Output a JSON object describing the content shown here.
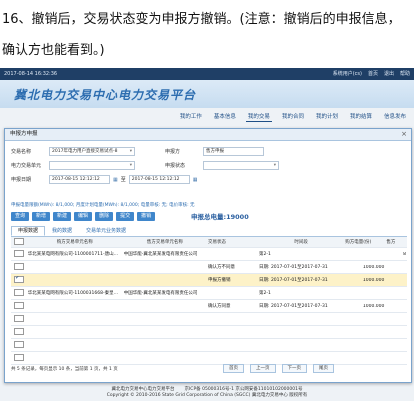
{
  "caption": {
    "line1": "16、撤销后，交易状态变为申报方撤销。(注意：撤销后的申报信息，",
    "line2": "确认方也能看到。)"
  },
  "topbar": {
    "left": "2017-08-14 16:32:36",
    "user": "系统用户(cs)",
    "home": "首页",
    "logout": "退出",
    "help": "帮助"
  },
  "banner": {
    "title": "冀北电力交易中心电力交易平台"
  },
  "nav": [
    "我的工作",
    "基本信息",
    "我的交易",
    "我的合同",
    "我的计划",
    "我的结算",
    "信息发布"
  ],
  "modal": {
    "title": "申报方申报",
    "close": "×",
    "fields": {
      "project_label": "交易名称",
      "project_value": "2017年电力用户直接交易试点-8",
      "declarer_label": "申报方",
      "declarer_value": "售方申报",
      "unit_label": "电力交易单元",
      "status_label": "申报状态",
      "date_label": "申报日期",
      "date_from": "2017-08-15 12:12:12",
      "date_sep": "至",
      "date_to": "2017-08-15 12:12:12"
    },
    "info_line": "申报电量限额(MWh): 8/1,000; 月度计划电量(MWh): 8/1,000; 电量审核: 无; 电价审核: 无",
    "buttons": [
      "查询",
      "新增",
      "新建",
      "编辑",
      "删除",
      "提交",
      "撤销"
    ],
    "total_label": "申报总电量:19000",
    "tabs": [
      "申报数据",
      "我的数据",
      "交易单元业务数据"
    ],
    "columns": [
      "",
      "购方交易单元名称",
      "售方交易单元名称",
      "交易状态",
      "时间段",
      "购方电量(份)",
      "售方"
    ],
    "rows": [
      {
        "checked": false,
        "buyer": "华北某某电网有限公司-1100001711-唐山市某某电工电器有限公司",
        "seller": "中国华能-冀北某某发电有限责任公司",
        "status": "",
        "period": "第2-1",
        "buy": "",
        "sell": "8"
      },
      {
        "checked": false,
        "buyer": "",
        "seller": "",
        "status": "确认方不同意",
        "period": "日期: 2017-07-01至2017-07-31",
        "buy": "1000.000",
        "sell": ""
      },
      {
        "checked": true,
        "buyer": "",
        "seller": "",
        "status": "申报方撤销",
        "period": "日期: 2017-07-01至2017-07-31",
        "buy": "1000.000",
        "sell": ""
      },
      {
        "checked": false,
        "buyer": "华北某某电网有限公司-1100031668-秦皇岛市某某电工有限公司",
        "seller": "中国华能-冀北某某发电有限责任公司",
        "status": "",
        "period": "第2-1",
        "buy": "",
        "sell": ""
      },
      {
        "checked": false,
        "buyer": "",
        "seller": "",
        "status": "确认方同意",
        "period": "日期: 2017-07-01至2017-07-31",
        "buy": "1000.000",
        "sell": ""
      },
      {
        "checked": false,
        "buyer": "",
        "seller": "",
        "status": "",
        "period": "",
        "buy": "",
        "sell": ""
      },
      {
        "checked": false,
        "buyer": "",
        "seller": "",
        "status": "",
        "period": "",
        "buy": "",
        "sell": ""
      },
      {
        "checked": false,
        "buyer": "",
        "seller": "",
        "status": "",
        "period": "",
        "buy": "",
        "sell": ""
      },
      {
        "checked": false,
        "buyer": "",
        "seller": "",
        "status": "",
        "period": "",
        "buy": "",
        "sell": ""
      }
    ],
    "pager": {
      "summary": "共 5 条记录，每页显示 10 条，当前第 1 页，共 1 页",
      "first": "首页",
      "prev": "上一页",
      "next": "下一页",
      "last": "尾页"
    }
  },
  "footer": {
    "line1a": "冀北电力交易中心电力交易平台",
    "line1b": "京ICP备 05000316号-1  京公网安备11010102000001号",
    "line2": "Copyright © 2010-2016 State Grid Corporation of China (SGCC)  冀北电力交易中心 版权所有"
  }
}
